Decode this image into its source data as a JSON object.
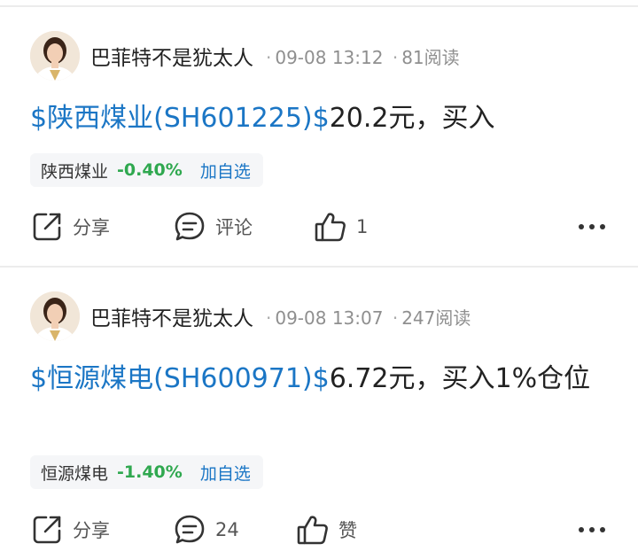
{
  "posts": [
    {
      "author": "巴菲特不是犹太人",
      "time": "09-08 13:12",
      "reads": "81阅读",
      "stock_link": "$陕西煤业(SH601225)$",
      "text": "20.2元，买入",
      "stock_card": {
        "name": "陕西煤业",
        "change": "-0.40%",
        "watch": "加自选"
      },
      "actions": {
        "share": "分享",
        "comment": "评论",
        "like": "1"
      }
    },
    {
      "author": "巴菲特不是犹太人",
      "time": "09-08 13:07",
      "reads": "247阅读",
      "stock_link": "$恒源煤电(SH600971)$",
      "text": "6.72元，买入1%仓位",
      "stock_card": {
        "name": "恒源煤电",
        "change": "-1.40%",
        "watch": "加自选"
      },
      "actions": {
        "share": "分享",
        "comment": "24",
        "like": "赞"
      }
    }
  ],
  "colors": {
    "link": "#1b76c5",
    "down": "#2fa84f",
    "meta": "#8f8f8f"
  }
}
